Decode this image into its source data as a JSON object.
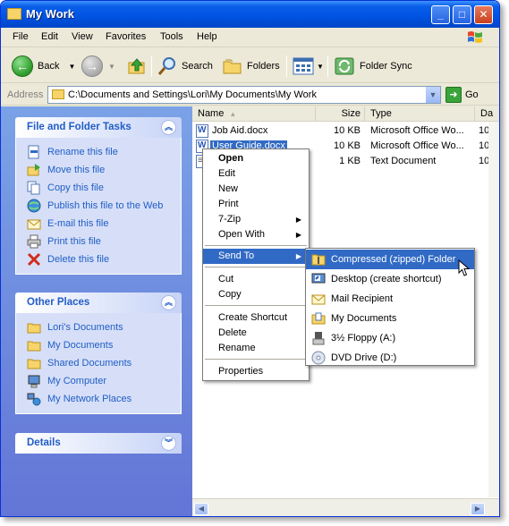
{
  "window": {
    "title": "My Work"
  },
  "title_buttons": {
    "minimize": "_",
    "maximize": "□",
    "close": "✕"
  },
  "menu": [
    "File",
    "Edit",
    "View",
    "Favorites",
    "Tools",
    "Help"
  ],
  "toolbar": {
    "back": "Back",
    "search": "Search",
    "folders": "Folders",
    "folder_sync": "Folder Sync"
  },
  "address": {
    "label": "Address",
    "value": "C:\\Documents and Settings\\Lori\\My Documents\\My Work",
    "go": "Go"
  },
  "tasks": {
    "file_folder": {
      "title": "File and Folder Tasks",
      "items": [
        {
          "label": "Rename this file",
          "icon": "rename-icon"
        },
        {
          "label": "Move this file",
          "icon": "move-icon"
        },
        {
          "label": "Copy this file",
          "icon": "copy-icon"
        },
        {
          "label": "Publish this file to the Web",
          "icon": "publish-web-icon"
        },
        {
          "label": "E-mail this file",
          "icon": "email-icon"
        },
        {
          "label": "Print this file",
          "icon": "printer-icon"
        },
        {
          "label": "Delete this file",
          "icon": "delete-icon"
        }
      ]
    },
    "other_places": {
      "title": "Other Places",
      "items": [
        {
          "label": "Lori's Documents",
          "icon": "folder-icon"
        },
        {
          "label": "My Documents",
          "icon": "folder-icon"
        },
        {
          "label": "Shared Documents",
          "icon": "folder-icon"
        },
        {
          "label": "My Computer",
          "icon": "computer-icon"
        },
        {
          "label": "My Network Places",
          "icon": "network-icon"
        }
      ]
    },
    "details": {
      "title": "Details"
    }
  },
  "columns": {
    "name": "Name",
    "size": "Size",
    "type": "Type",
    "date": "Da"
  },
  "files": [
    {
      "name": "Job Aid.docx",
      "size": "10 KB",
      "type": "Microsoft Office Wo...",
      "date": "10/"
    },
    {
      "name": "User Guide.docx",
      "size": "10 KB",
      "type": "Microsoft Office Wo...",
      "date": "10/"
    },
    {
      "name": "",
      "size": "1 KB",
      "type": "Text Document",
      "date": "10/"
    }
  ],
  "context_menu": {
    "open": "Open",
    "edit": "Edit",
    "new": "New",
    "print": "Print",
    "zip": "7-Zip",
    "open_with": "Open With",
    "send_to": "Send To",
    "cut": "Cut",
    "copy": "Copy",
    "create_shortcut": "Create Shortcut",
    "delete": "Delete",
    "rename": "Rename",
    "properties": "Properties",
    "arrow": "▶"
  },
  "send_to": [
    {
      "label": "Compressed (zipped) Folder",
      "icon": "zip-folder-icon"
    },
    {
      "label": "Desktop (create shortcut)",
      "icon": "desktop-icon"
    },
    {
      "label": "Mail Recipient",
      "icon": "mail-icon"
    },
    {
      "label": "My Documents",
      "icon": "my-documents-icon"
    },
    {
      "label": "3½ Floppy (A:)",
      "icon": "floppy-icon"
    },
    {
      "label": "DVD Drive (D:)",
      "icon": "dvd-icon"
    }
  ],
  "colors": {
    "titlebar": "#0054e3",
    "task_pane": "#7ba2e7",
    "selection": "#316ac5",
    "task_link": "#215dc6"
  }
}
